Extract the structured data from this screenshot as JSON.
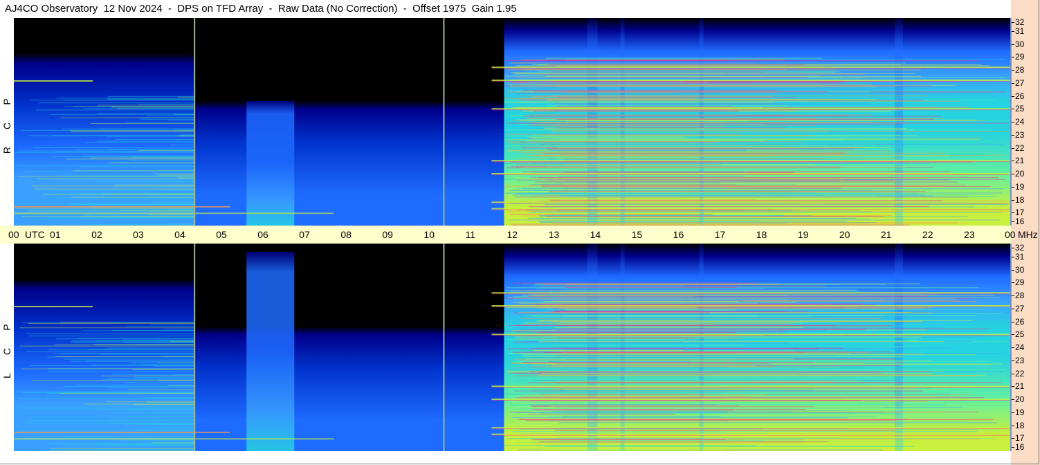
{
  "title": "AJ4CO Observatory  12 Nov 2024  -  DPS on TFD Array  -  Raw Data (No Correction)  -  Offset 1975  Gain 1.95",
  "chart_data": {
    "type": "heatmap",
    "x_axis": {
      "unit": "UTC",
      "tick_labels": [
        "00",
        "UTC",
        "01",
        "02",
        "03",
        "04",
        "05",
        "06",
        "07",
        "08",
        "09",
        "10",
        "11",
        "12",
        "13",
        "14",
        "15",
        "16",
        "17",
        "18",
        "19",
        "20",
        "21",
        "22",
        "23",
        "00"
      ],
      "range_hours": [
        0,
        24
      ]
    },
    "y_axis": {
      "unit": "MHz",
      "tick_labels": [
        "16",
        "17",
        "18",
        "19",
        "20",
        "21",
        "22",
        "23",
        "24",
        "25",
        "26",
        "27",
        "28",
        "29",
        "30",
        "31",
        "32"
      ],
      "range_mhz": [
        16,
        32
      ]
    },
    "panels": [
      {
        "name": "RCP",
        "letters": [
          "P",
          "C",
          "R"
        ]
      },
      {
        "name": "LCP",
        "letters": [
          "P",
          "C",
          "L"
        ]
      }
    ],
    "colormap": [
      "#000000",
      "#00008b",
      "#0033cc",
      "#1e6bff",
      "#3aa0ff",
      "#26d3e0",
      "#60f0a0",
      "#c8f03c",
      "#ff9a3c",
      "#ff2c8c"
    ],
    "noise_bands": [
      {
        "start_h": 5.6,
        "end_h": 6.75,
        "note": "broadband interference band"
      },
      {
        "start_h": 13.8,
        "end_h": 14.05
      },
      {
        "start_h": 14.6,
        "end_h": 14.7
      },
      {
        "start_h": 16.5,
        "end_h": 16.6
      },
      {
        "start_h": 21.2,
        "end_h": 21.4
      }
    ],
    "marker_lines_h": [
      4.35,
      10.35
    ],
    "strong_frequencies_mhz": [
      17.3,
      17.8,
      20.0,
      21.0,
      25.0,
      27.2,
      28.2
    ],
    "sunrise_h": 12.0
  }
}
